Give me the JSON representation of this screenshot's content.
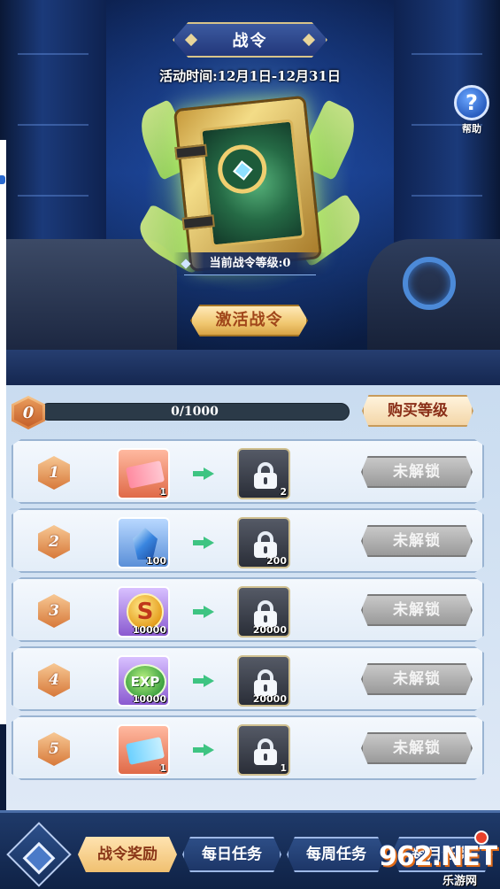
{
  "header": {
    "title": "战令",
    "event_time": "活动时间:12月1日-12月31日",
    "help_label": "帮助",
    "help_icon": "?"
  },
  "pass": {
    "current_level_text": "当前战令等级:0",
    "activate_label": "激活战令"
  },
  "progress": {
    "level": "0",
    "text": "0/1000",
    "current": 0,
    "max": 1000,
    "buy_label": "购买等级"
  },
  "rewards": [
    {
      "level": "1",
      "free_icon": "ticket-icon",
      "free_qty": "1",
      "paid_qty": "2",
      "status": "未解锁"
    },
    {
      "level": "2",
      "free_icon": "crystal-icon",
      "free_qty": "100",
      "paid_qty": "200",
      "status": "未解锁"
    },
    {
      "level": "3",
      "free_icon": "gold-coin-icon",
      "free_coin_letter": "S",
      "free_qty": "10000",
      "paid_qty": "20000",
      "status": "未解锁"
    },
    {
      "level": "4",
      "free_icon": "exp-icon",
      "free_exp_text": "EXP",
      "free_qty": "10000",
      "paid_qty": "20000",
      "status": "未解锁"
    },
    {
      "level": "5",
      "free_icon": "ticket-icon",
      "free_qty": "1",
      "paid_qty": "1",
      "status": "未解锁"
    }
  ],
  "nav": {
    "tabs": [
      {
        "label": "战令奖励",
        "active": true
      },
      {
        "label": "每日任务",
        "active": false
      },
      {
        "label": "每周任务",
        "active": false
      },
      {
        "label": "每月任务",
        "active": false
      }
    ]
  },
  "watermark": {
    "logo": "962.NET",
    "text": "乐游网"
  },
  "colors": {
    "progress_fill": "#f3a548",
    "unlock_disabled": "#9a9a9a",
    "arrow": "#3ec482",
    "notification": "#e8402a"
  }
}
